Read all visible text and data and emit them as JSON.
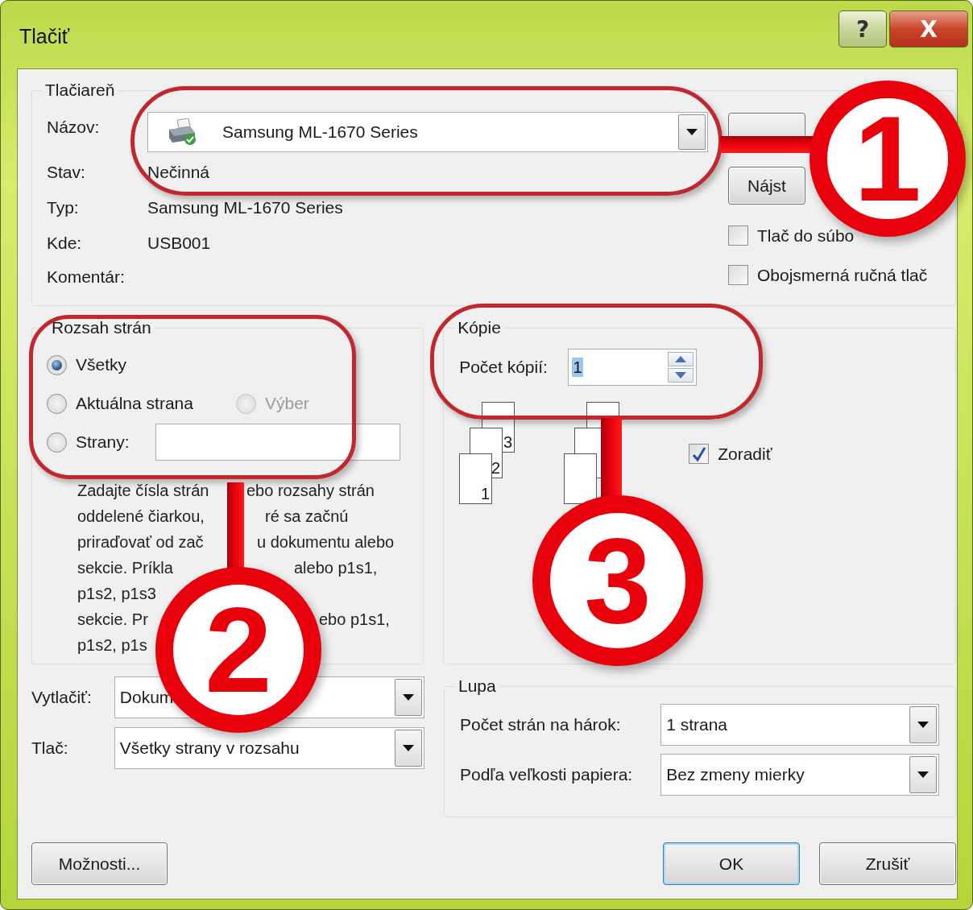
{
  "window": {
    "title": "Tlačiť",
    "help_button": "?",
    "close_button": "X"
  },
  "printer": {
    "legend": "Tlačiareň",
    "fields": [
      {
        "label": "Názov:",
        "kind": "select",
        "value": "Samsung ML-1670 Series"
      },
      {
        "label": "Stav:",
        "kind": "text",
        "value": "Nečinná"
      },
      {
        "label": "Typ:",
        "kind": "text",
        "value": "Samsung ML-1670 Series"
      },
      {
        "label": "Kde:",
        "kind": "text",
        "value": "USB001"
      },
      {
        "label": "Komentár:",
        "kind": "text"
      }
    ],
    "find_button": "Nájst",
    "checkboxes": [
      {
        "label": "Tlač do súbo",
        "checked": false
      },
      {
        "label": "Obojsmerná ručná tlač",
        "checked": false
      }
    ]
  },
  "page_range": {
    "legend": "Rozsah strán",
    "options": [
      {
        "label": "Všetky",
        "selected": true,
        "disabled": false
      },
      {
        "label": "Aktuálna strana",
        "selected": false,
        "disabled": false
      },
      {
        "label": "Výber",
        "selected": false,
        "disabled": true
      },
      {
        "label": "Strany:",
        "selected": false,
        "disabled": false
      }
    ],
    "help_lines": [
      {
        "left": "Zadajte čísla strán",
        "right": "ebo rozsahy strán"
      },
      {
        "left": "oddelené čiarkou,",
        "right": "ré sa začnú"
      },
      {
        "left": "priraďovať od zač",
        "right": "u dokumentu alebo"
      },
      {
        "left": "sekcie. Príkla",
        "right": "alebo p1s1,"
      },
      {
        "left": "p1s2, p1s3"
      },
      {
        "left": "sekcie. Pr",
        "right": "ebo p1s1,"
      },
      {
        "left": "p1s2, p1s"
      }
    ]
  },
  "copies": {
    "legend": "Kópie",
    "count_label": "Počet kópií:",
    "count": "1",
    "stack_labels": [
      "3",
      "2",
      "1"
    ],
    "collate": {
      "label": "Zoradiť",
      "checked": true
    }
  },
  "print_what": [
    {
      "label": "Vytlačiť:",
      "value": "Dokum"
    },
    {
      "label": "Tlač:",
      "value": "Všetky strany v rozsahu"
    }
  ],
  "zoom": {
    "legend": "Lupa",
    "rows": [
      {
        "label": "Počet strán na hárok:",
        "value": "1 strana"
      },
      {
        "label": "Podľa veľkosti papiera:",
        "value": "Bez zmeny mierky"
      }
    ]
  },
  "footer": {
    "options_button": "Možnosti...",
    "ok_button": "OK",
    "cancel_button": "Zrušiť"
  },
  "callouts": [
    {
      "number": "1"
    },
    {
      "number": "2"
    },
    {
      "number": "3"
    }
  ]
}
